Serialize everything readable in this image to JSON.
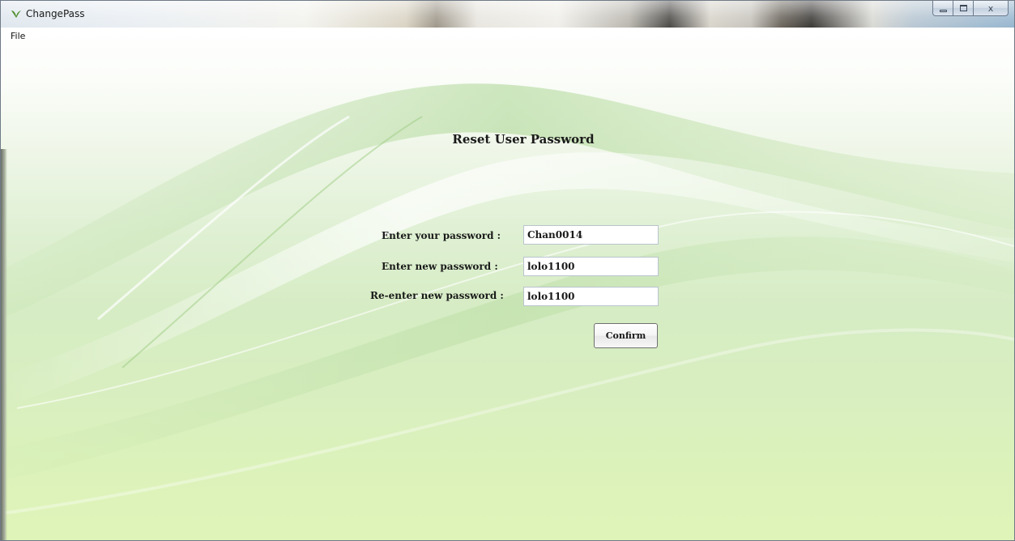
{
  "window": {
    "title": "ChangePass",
    "minimize_label": "",
    "maximize_label": "",
    "close_label": "x"
  },
  "menu": {
    "items": [
      {
        "label": "File"
      }
    ]
  },
  "form": {
    "heading": "Reset User Password",
    "current_password_label": "Enter your password :",
    "current_password_value": "Chan0014",
    "new_password_label": "Enter new password :",
    "new_password_value": "lolo1100",
    "confirm_password_label": "Re-enter new password :",
    "confirm_password_value": "lolo1100",
    "confirm_button_label": "Confirm"
  },
  "icons": {
    "app": "leaf-icon",
    "minimize": "minimize-icon",
    "maximize": "maximize-icon",
    "close": "close-icon"
  },
  "colors": {
    "background_top": "#ffffff",
    "background_bottom": "#dff4b8",
    "accent_green": "#4e8f2f"
  }
}
